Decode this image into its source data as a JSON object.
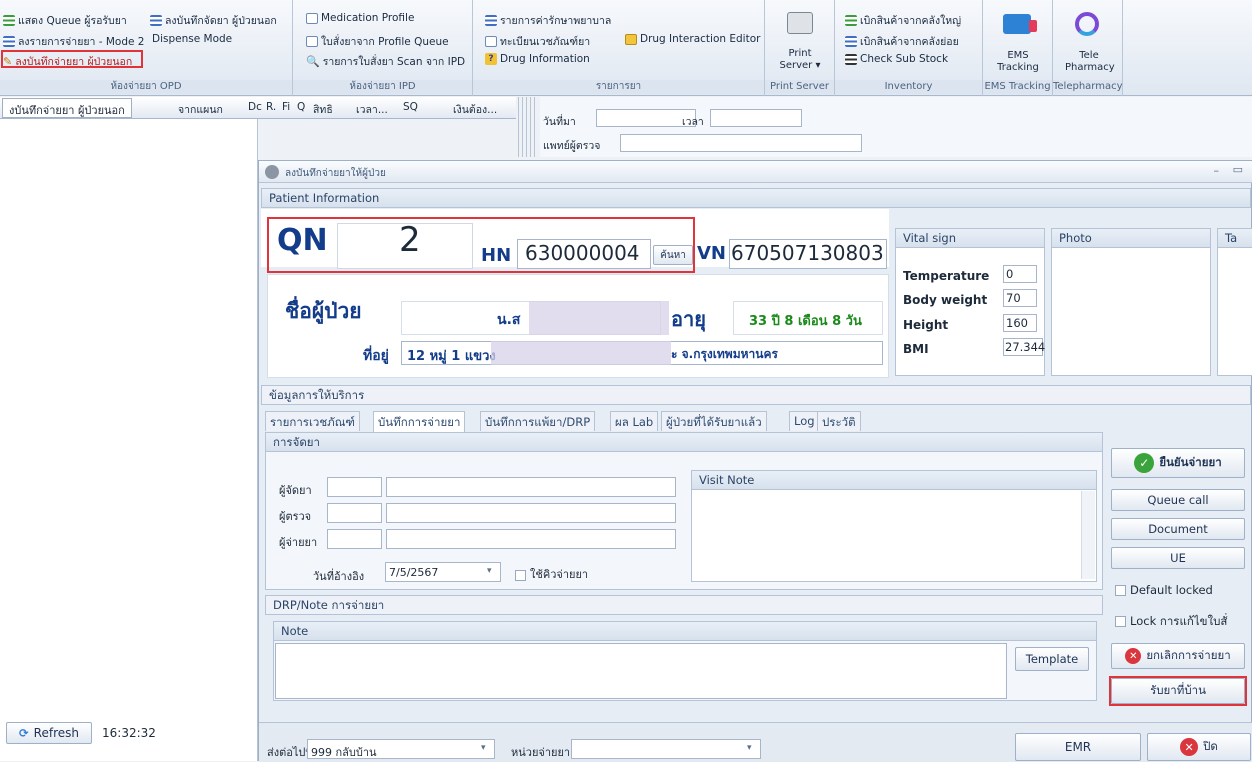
{
  "ribbon": {
    "opd": {
      "items": [
        "แสดง Queue ผู้รอรับยา",
        "ลงรายการจ่ายยา - Mode 2",
        "ลงบันทึกจ่ายยา ผู้ป่วยนอก",
        "ลงบันทึกจัดยา ผู้ป่วยนอก",
        "Dispense Mode"
      ],
      "group_label": "ห้องจ่ายยา OPD"
    },
    "ipd": {
      "items": [
        "Medication Profile",
        "ใบสั่งยาจาก Profile Queue",
        "รายการใบสั่งยา Scan จาก IPD"
      ],
      "group_label": "ห้องจ่ายยา IPD"
    },
    "lists": {
      "items": [
        "รายการค่ารักษาพยาบาล",
        "ทะเบียนเวชภัณฑ์ยา",
        "Drug Interaction Editor",
        "Drug Information"
      ],
      "group_label": "รายการยา"
    },
    "print": {
      "button": "Print Server",
      "group_label": "Print Server"
    },
    "inventory": {
      "items": [
        "เบิกสินค้าจากคลังใหญ่",
        "เบิกสินค้าจากคลังย่อย",
        "Check Sub Stock"
      ],
      "group_label": "Inventory"
    },
    "ems": {
      "button": "EMS Tracking",
      "group_label": "EMS Tracking"
    },
    "tele": {
      "button": "Tele Pharmacy",
      "group_label": "Telepharmacy"
    }
  },
  "left_grid": {
    "tab": "งบันทึกจ่ายยา ผู้ป่วยนอก",
    "columns": [
      "จากแผนก",
      "Dc",
      "R.",
      "Fi",
      "Q",
      "สิทธิ",
      "เวลา...",
      "SQ",
      "เงินต้อง..."
    ],
    "refresh_label": "Refresh",
    "time": "16:32:32"
  },
  "top_form": {
    "date_label": "วันที่มา",
    "time_label": "เวลา",
    "doctor_label": "แพทย์ผู้ตรวจ"
  },
  "dialog": {
    "title": "ลงบันทึกจ่ายยาให้ผู้ป่วย",
    "patient_info_header": "Patient Information",
    "qn_label": "QN",
    "qn_value": "2",
    "hn_label": "HN",
    "hn_value": "630000004",
    "search_button": "ค้นหา",
    "vn_label": "VN",
    "vn_value": "670507130803",
    "name_label": "ชื่อผู้ป่วย",
    "name_value": "น.ส",
    "age_label": "อายุ",
    "age_value": "33 ปี 8 เดือน 8 วัน",
    "address_label": "ที่อยู่",
    "address_value": "12 หมู่ 1 แขวง",
    "address_tail": "ะ จ.กรุงเทพมหานคร",
    "vital": {
      "header": "Vital sign",
      "rows": [
        {
          "label": "Temperature",
          "value": "0"
        },
        {
          "label": "Body weight",
          "value": "70"
        },
        {
          "label": "Height",
          "value": "160"
        },
        {
          "label": "BMI",
          "value": "27.344"
        }
      ]
    },
    "photo_header": "Photo",
    "extra_header": "Ta",
    "service_header": "ข้อมูลการให้บริการ",
    "tabs": [
      "รายการเวชภัณฑ์",
      "บันทึกการจ่ายยา",
      "บันทึกการแพ้ยา/DRP",
      "ผล Lab",
      "ผู้ป่วยที่ได้รับยาแล้ว",
      "Log",
      "ประวัติ"
    ],
    "dispense": {
      "header": "การจัดยา",
      "prep_label": "ผู้จัดยา",
      "check_label": "ผู้ตรวจ",
      "dispenser_label": "ผู้จ่ายยา",
      "ref_date_label": "วันที่อ้างอิง",
      "ref_date_value": "7/5/2567",
      "use_queue_label": "ใช้คิวจ่ายยา",
      "visit_note_header": "Visit Note"
    },
    "drp_header": "DRP/Note การจ่ายยา",
    "note_header": "Note",
    "template_button": "Template",
    "actions": {
      "confirm": "ยืนยันจ่ายยา",
      "queue_call": "Queue call",
      "document": "Document",
      "ue": "UE",
      "default_locked": "Default locked",
      "lock_edit": "Lock การแก้ไขใบสั่",
      "cancel_dispense": "ยกเลิกการจ่ายยา",
      "home_meds": "รับยาที่บ้าน"
    },
    "footer": {
      "send_to_label": "ส่งต่อไปที่",
      "send_to_value": "999 กลับบ้าน",
      "unit_label": "หน่วยจ่ายยา",
      "emr_button": "EMR",
      "close_button": "ปิด"
    }
  }
}
